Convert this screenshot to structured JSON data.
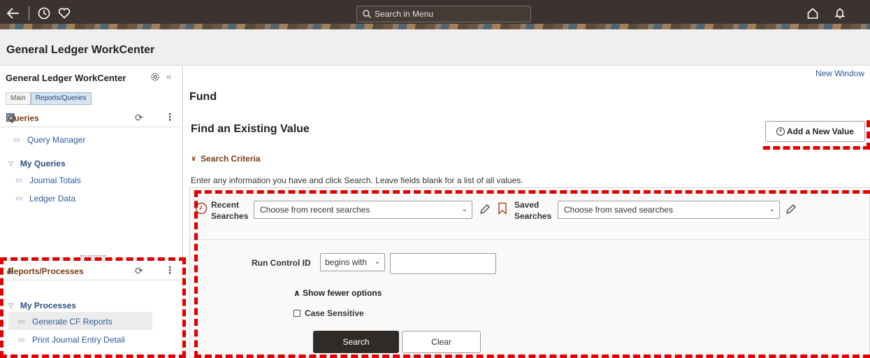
{
  "topbar": {
    "search_placeholder": "Search in Menu",
    "icons": [
      "back-arrow-icon",
      "history-icon",
      "favorites-icon",
      "home-icon",
      "notifications-icon"
    ]
  },
  "page": {
    "title": "General Ledger WorkCenter"
  },
  "left_panel": {
    "title": "General Ledger WorkCenter",
    "tabs": [
      {
        "label": "Main"
      },
      {
        "label": "Reports/Queries"
      }
    ],
    "queries": {
      "heading": "Queries",
      "items": [
        {
          "label": "Query Manager"
        }
      ],
      "my_queries": {
        "heading": "My Queries",
        "items": [
          {
            "label": "Journal Totals"
          },
          {
            "label": "Ledger Data"
          }
        ]
      }
    },
    "reports": {
      "heading": "Reports/Processes",
      "my_processes": {
        "heading": "My Processes",
        "items": [
          {
            "label": "Generate CF Reports"
          },
          {
            "label": "Print Journal Entry Detail"
          }
        ]
      }
    }
  },
  "main": {
    "new_window": "New Window",
    "component_title": "Fund",
    "find_title": "Find an Existing Value",
    "add_button": "Add a New Value",
    "criteria_heading": "Search Criteria",
    "instructions": "Enter any information you have and click Search. Leave fields blank for a list of all values.",
    "recent_label_1": "Recent",
    "recent_label_2": "Searches",
    "recent_select": "Choose from recent searches",
    "saved_label_1": "Saved",
    "saved_label_2": "Searches",
    "saved_select": "Choose from saved searches",
    "run_control_label": "Run Control ID",
    "run_control_op": "begins with",
    "run_control_value": "",
    "show_fewer": "Show fewer options",
    "case_sensitive": "Case Sensitive",
    "search_button": "Search",
    "clear_button": "Clear"
  },
  "colors": {
    "annotation": "#e00000",
    "link": "#2d5a99",
    "section_heading": "#7a3c15"
  }
}
